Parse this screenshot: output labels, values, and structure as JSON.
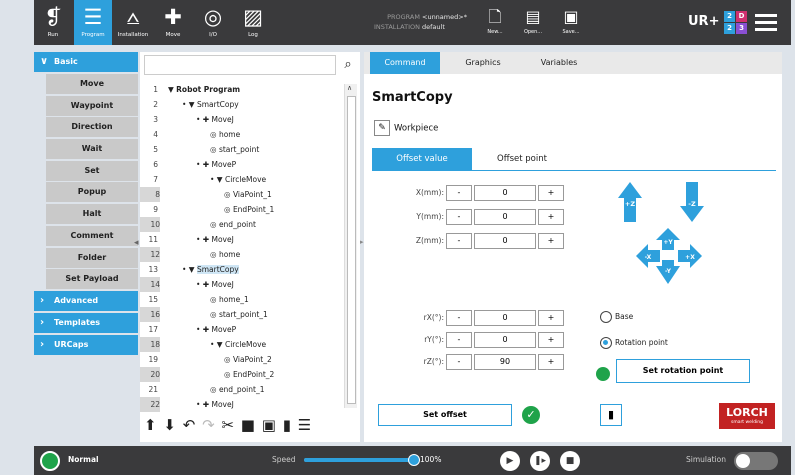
{
  "topbar": {
    "nav": [
      {
        "label": "Run",
        "icon": "ur-logo-icon"
      },
      {
        "label": "Program",
        "icon": "program-icon",
        "active": true
      },
      {
        "label": "Installation",
        "icon": "installation-icon"
      },
      {
        "label": "Move",
        "icon": "move-icon"
      },
      {
        "label": "I/O",
        "icon": "io-icon"
      },
      {
        "label": "Log",
        "icon": "log-icon"
      }
    ],
    "program_label": "PROGRAM",
    "program_value": "<unnamed>*",
    "installation_label": "INSTALLATION",
    "installation_value": "default",
    "file_buttons": [
      {
        "label": "New..."
      },
      {
        "label": "Open..."
      },
      {
        "label": "Save..."
      }
    ]
  },
  "leftnav": {
    "basic_label": "Basic",
    "basic_items": [
      "Move",
      "Waypoint",
      "Direction",
      "Wait",
      "Set",
      "Popup",
      "Halt",
      "Comment",
      "Folder",
      "Set Payload"
    ],
    "collapsed": [
      "Advanced",
      "Templates",
      "URCaps"
    ]
  },
  "tree": {
    "rows": [
      {
        "n": "1",
        "t": "Robot Program",
        "d": 0,
        "bold": true
      },
      {
        "n": "2",
        "t": "SmartCopy",
        "d": 1
      },
      {
        "n": "3",
        "t": "MoveJ",
        "d": 2
      },
      {
        "n": "4",
        "t": "home",
        "d": 3
      },
      {
        "n": "5",
        "t": "start_point",
        "d": 3
      },
      {
        "n": "6",
        "t": "MoveP",
        "d": 2
      },
      {
        "n": "7",
        "t": "CircleMove",
        "d": 3
      },
      {
        "n": "8",
        "t": "ViaPoint_1",
        "d": 4
      },
      {
        "n": "9",
        "t": "EndPoint_1",
        "d": 4
      },
      {
        "n": "10",
        "t": "end_point",
        "d": 3
      },
      {
        "n": "11",
        "t": "MoveJ",
        "d": 2
      },
      {
        "n": "12",
        "t": "home",
        "d": 3
      },
      {
        "n": "13",
        "t": "SmartCopy",
        "d": 1,
        "selected": true
      },
      {
        "n": "14",
        "t": "MoveJ",
        "d": 2
      },
      {
        "n": "15",
        "t": "home_1",
        "d": 3
      },
      {
        "n": "16",
        "t": "start_point_1",
        "d": 3
      },
      {
        "n": "17",
        "t": "MoveP",
        "d": 2
      },
      {
        "n": "18",
        "t": "CircleMove",
        "d": 3
      },
      {
        "n": "19",
        "t": "ViaPoint_2",
        "d": 4
      },
      {
        "n": "20",
        "t": "EndPoint_2",
        "d": 4
      },
      {
        "n": "21",
        "t": "end_point_1",
        "d": 3
      },
      {
        "n": "22",
        "t": "MoveJ",
        "d": 2
      }
    ]
  },
  "panel": {
    "tabs": [
      "Command",
      "Graphics",
      "Variables"
    ],
    "title": "SmartCopy",
    "workpiece_label": "Workpiece",
    "subtabs": [
      "Offset value",
      "Offset point"
    ],
    "offset_fields": [
      {
        "label": "X(mm):",
        "value": "0"
      },
      {
        "label": "Y(mm):",
        "value": "0"
      },
      {
        "label": "Z(mm):",
        "value": "0"
      }
    ],
    "rot_fields": [
      {
        "label": "rX(°):",
        "value": "0"
      },
      {
        "label": "rY(°):",
        "value": "0"
      },
      {
        "label": "rZ(°):",
        "value": "90"
      }
    ],
    "minus": "-",
    "plus": "+",
    "arrows": {
      "pz": "+Z",
      "mz": "-Z",
      "py": "+Y",
      "my": "-Y",
      "mx": "-X",
      "px": "+X"
    },
    "radio_base": "Base",
    "radio_rot": "Rotation point",
    "set_rotation_label": "Set rotation point",
    "set_offset_label": "Set offset",
    "logo_main": "LORCH",
    "logo_sub": "smart welding"
  },
  "bottombar": {
    "mode": "Normal",
    "speed_label": "Speed",
    "speed_percent": "100%",
    "speed_value": 1.0,
    "simulation_label": "Simulation"
  }
}
